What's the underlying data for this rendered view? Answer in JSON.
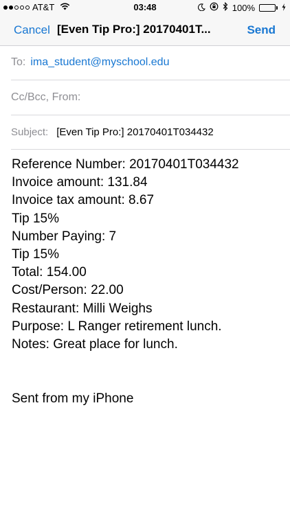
{
  "status_bar": {
    "carrier": "AT&T",
    "signal_bars_filled": 2,
    "signal_bars_total": 5,
    "time": "03:48",
    "battery_percent": "100%",
    "battery_level": 1.0,
    "battery_color": "#4cd964"
  },
  "nav": {
    "cancel_label": "Cancel",
    "title": "[Even Tip Pro:] 20170401T...",
    "send_label": "Send",
    "accent_color": "#1877d2"
  },
  "header": {
    "to_label": "To:",
    "to_value": "ima_student@myschool.edu",
    "cc_label": "Cc/Bcc, From:",
    "subject_label": "Subject:",
    "subject_value": "[Even Tip Pro:] 20170401T034432"
  },
  "body": {
    "lines": [
      "Reference Number: 20170401T034432",
      "Invoice amount: 131.84",
      "Invoice tax amount: 8.67",
      "Tip 15%",
      "Number Paying: 7",
      "Tip 15%",
      "Total: 154.00",
      "Cost/Person: 22.00",
      "Restaurant: Milli Weighs",
      "Purpose: L Ranger retirement lunch.",
      "Notes: Great place for lunch."
    ],
    "signature": "Sent from my iPhone"
  },
  "icons": {
    "wifi": "wifi-icon",
    "moon": "moon-icon",
    "rotation_lock": "rotation-lock-icon",
    "bluetooth": "bluetooth-icon",
    "battery": "battery-icon",
    "charging": "charging-bolt-icon"
  }
}
